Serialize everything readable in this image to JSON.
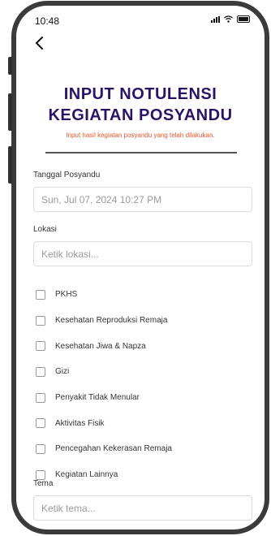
{
  "status_bar": {
    "time": "10:48"
  },
  "header": {
    "title_line1": "INPUT NOTULENSI",
    "title_line2": "KEGIATAN POSYANDU",
    "subtitle": "Input hasil kegiatan posyandu yang telah dilakukan."
  },
  "form": {
    "date": {
      "label": "Tanggal Posyandu",
      "value": "Sun, Jul 07, 2024 10:27 PM"
    },
    "location": {
      "label": "Lokasi",
      "placeholder": "Ketik lokasi..."
    },
    "checkboxes": [
      {
        "label": "PKHS",
        "checked": false
      },
      {
        "label": "Kesehatan Reproduksi Remaja",
        "checked": false
      },
      {
        "label": "Kesehatan Jiwa & Napza",
        "checked": false
      },
      {
        "label": "Gizi",
        "checked": false
      },
      {
        "label": "Penyakit Tidak Menular",
        "checked": false
      },
      {
        "label": "Aktivitas Fisik",
        "checked": false
      },
      {
        "label": "Pencegahan Kekerasan Remaja",
        "checked": false
      },
      {
        "label": "Kegiatan Lainnya",
        "checked": false
      }
    ],
    "theme": {
      "label": "Tema",
      "placeholder": "Ketik tema..."
    }
  },
  "colors": {
    "title": "#2b1466",
    "subtitle": "#e8542a",
    "frame": "#3b3b3b"
  },
  "icons": {
    "back": "chevron-left-icon",
    "signal": "signal-icon",
    "wifi": "wifi-icon",
    "battery": "battery-icon"
  }
}
